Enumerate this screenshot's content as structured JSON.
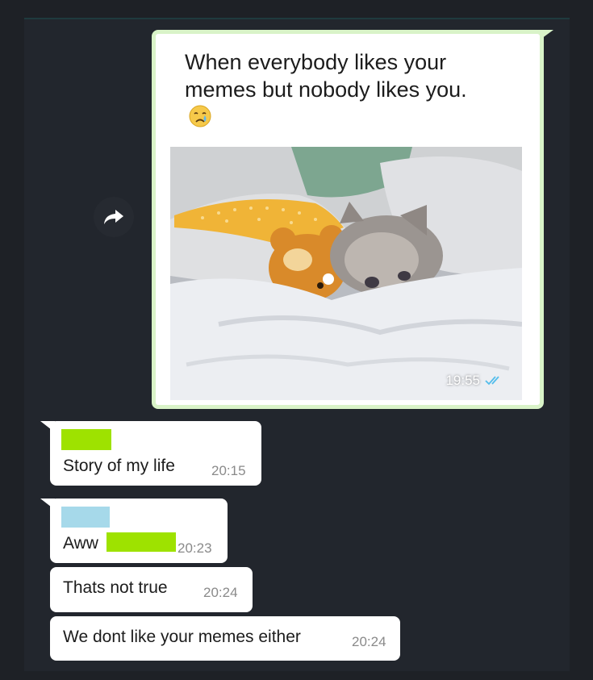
{
  "colors": {
    "background": "#1e2126",
    "sent_bubble_border": "#d9f3c8",
    "green_redaction": "#9ee200",
    "blue_redaction": "#a6d9ea",
    "read_ticks": "#53bdeb"
  },
  "icons": {
    "forward": "forward-arrow-icon",
    "read_receipt": "double-check-icon",
    "emoji": "crying-face-emoji"
  },
  "sent_message": {
    "caption": "When everybody likes your memes but nobody likes you.",
    "emoji": "😢",
    "image": "sad-kitten-in-bed-with-teddy-bear",
    "time": "19:55",
    "status": "read"
  },
  "replies": [
    {
      "text": "Story of my life",
      "time": "20:15",
      "sender_redacted": true,
      "sender_color": "green"
    },
    {
      "text": "Aww",
      "time": "20:23",
      "sender_redacted": true,
      "sender_color": "blue",
      "inline_redaction": true
    },
    {
      "text": "Thats not true",
      "time": "20:24"
    },
    {
      "text": "We dont like your memes either",
      "time": "20:24"
    }
  ]
}
